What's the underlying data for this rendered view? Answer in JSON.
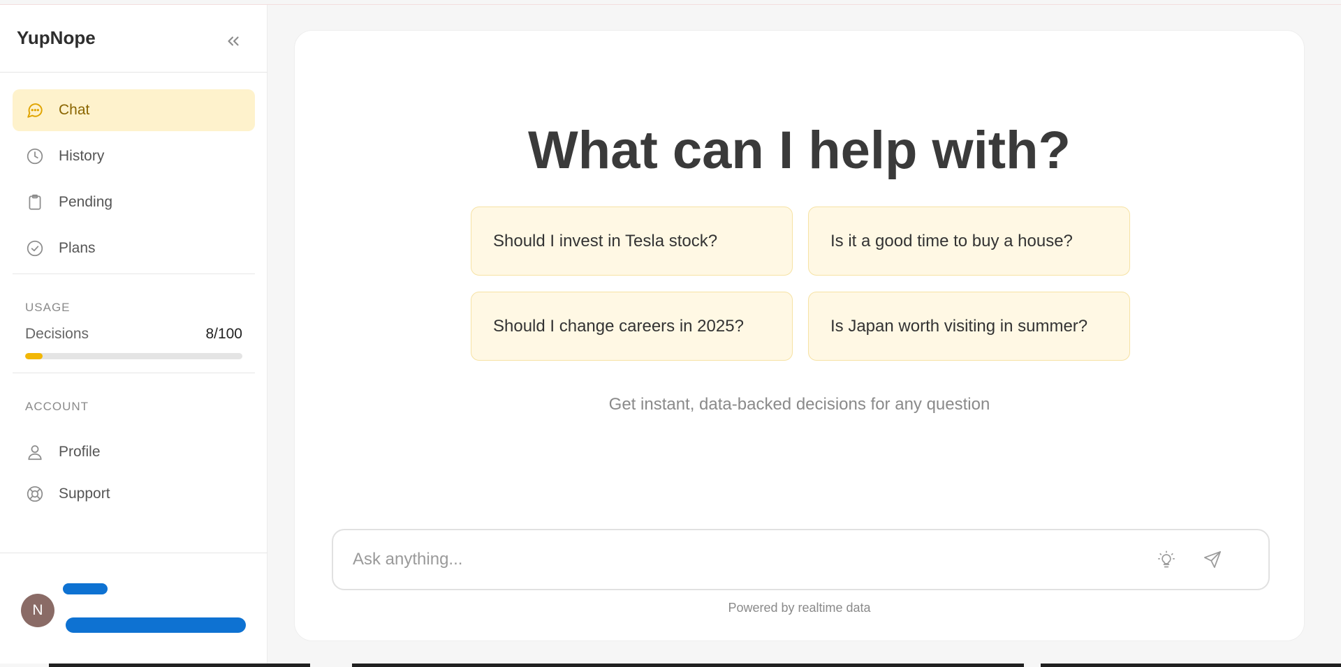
{
  "app": {
    "brand": "YupNope"
  },
  "sidebar": {
    "nav": [
      {
        "label": "Chat",
        "icon": "chat-bubble-icon",
        "active": true
      },
      {
        "label": "History",
        "icon": "clock-icon",
        "active": false
      },
      {
        "label": "Pending",
        "icon": "clipboard-icon",
        "active": false
      },
      {
        "label": "Plans",
        "icon": "check-circle-icon",
        "active": false
      }
    ],
    "usage": {
      "section_label": "USAGE",
      "name": "Decisions",
      "value_text": "8/100",
      "used": 8,
      "total": 100
    },
    "account": {
      "section_label": "ACCOUNT",
      "items": [
        {
          "label": "Profile",
          "icon": "user-icon"
        },
        {
          "label": "Support",
          "icon": "lifebuoy-icon"
        }
      ]
    },
    "user": {
      "initial": "N"
    }
  },
  "main": {
    "headline": "What can I help with?",
    "suggestions": [
      "Should I invest in Tesla stock?",
      "Is it a good time to buy a house?",
      "Should I change careers in 2025?",
      "Is Japan worth visiting in summer?"
    ],
    "tagline": "Get instant, data-backed decisions for any question",
    "input": {
      "placeholder": "Ask anything...",
      "value": ""
    },
    "powered_by": "Powered by realtime data"
  },
  "colors": {
    "accent": "#f2b705",
    "active_bg": "#fef2cc",
    "active_text": "#8a6500",
    "chip_bg": "#fff8e4",
    "chip_border": "#f6e2a4",
    "avatar_bg": "#8a6b66"
  }
}
